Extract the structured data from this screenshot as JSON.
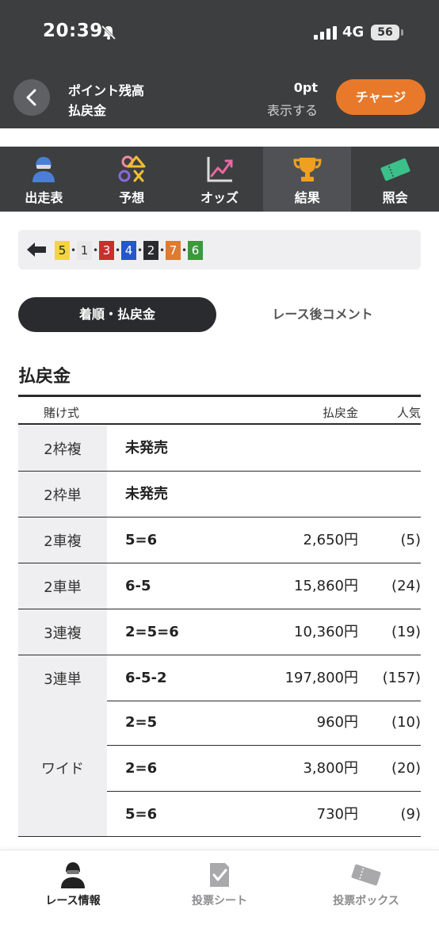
{
  "status_bar": {
    "time": "20:39",
    "network": "4G",
    "battery": "56"
  },
  "header": {
    "back_icon": "chevron-left-icon",
    "points_label": "ポイント残高",
    "refund_label": "払戻金",
    "points_value": "0pt",
    "show_label": "表示する",
    "charge_button": "チャージ"
  },
  "tabs": [
    {
      "label": "出走表",
      "icon": "racer-icon"
    },
    {
      "label": "予想",
      "icon": "prediction-icon"
    },
    {
      "label": "オッズ",
      "icon": "odds-chart-icon"
    },
    {
      "label": "結果",
      "icon": "trophy-icon",
      "active": true
    },
    {
      "label": "照会",
      "icon": "ticket-icon"
    }
  ],
  "finish_order": {
    "icon": "arrow-left-icon",
    "numbers": [
      "5",
      "1",
      "3",
      "4",
      "2",
      "7",
      "6"
    ],
    "colors": {
      "5": {
        "bg": "#f5d442",
        "fg": "#222222"
      },
      "1": {
        "bg": "#e8e8e8",
        "fg": "#333333"
      },
      "3": {
        "bg": "#c8302c",
        "fg": "#ffffff"
      },
      "4": {
        "bg": "#2458c8",
        "fg": "#ffffff"
      },
      "2": {
        "bg": "#2a2b2e",
        "fg": "#ffffff"
      },
      "7": {
        "bg": "#e07a2e",
        "fg": "#ffffff"
      },
      "6": {
        "bg": "#3a9a3a",
        "fg": "#ffffff"
      }
    }
  },
  "segments": {
    "active": "着順・払戻金",
    "inactive": "レース後コメント"
  },
  "payout_section": {
    "title": "払戻金",
    "headers": {
      "type": "賭け式",
      "payout": "払戻金",
      "popularity": "人気"
    },
    "rows": [
      {
        "type": "2枠複",
        "combo": "未発売",
        "payout": "",
        "popularity": ""
      },
      {
        "type": "2枠単",
        "combo": "未発売",
        "payout": "",
        "popularity": ""
      },
      {
        "type": "2車複",
        "combo": "5=6",
        "payout": "2,650円",
        "popularity": "(5)"
      },
      {
        "type": "2車単",
        "combo": "6-5",
        "payout": "15,860円",
        "popularity": "(24)"
      },
      {
        "type": "3連複",
        "combo": "2=5=6",
        "payout": "10,360円",
        "popularity": "(19)"
      },
      {
        "type": "3連単",
        "combo": "6-5-2",
        "payout": "197,800円",
        "popularity": "(157)"
      }
    ],
    "wide": {
      "type": "ワイド",
      "rows": [
        {
          "combo": "2=5",
          "payout": "960円",
          "popularity": "(10)"
        },
        {
          "combo": "2=6",
          "payout": "3,800円",
          "popularity": "(20)"
        },
        {
          "combo": "5=6",
          "payout": "730円",
          "popularity": "(9)"
        }
      ]
    }
  },
  "bottom_nav": [
    {
      "label": "レース情報",
      "icon": "racer-icon",
      "active": true
    },
    {
      "label": "投票シート",
      "icon": "vote-sheet-icon"
    },
    {
      "label": "投票ボックス",
      "icon": "ticket-box-icon"
    }
  ],
  "colors": {
    "dark": "#3d3e40",
    "accent": "#e8792a",
    "cell_bg": "#efeff1"
  }
}
